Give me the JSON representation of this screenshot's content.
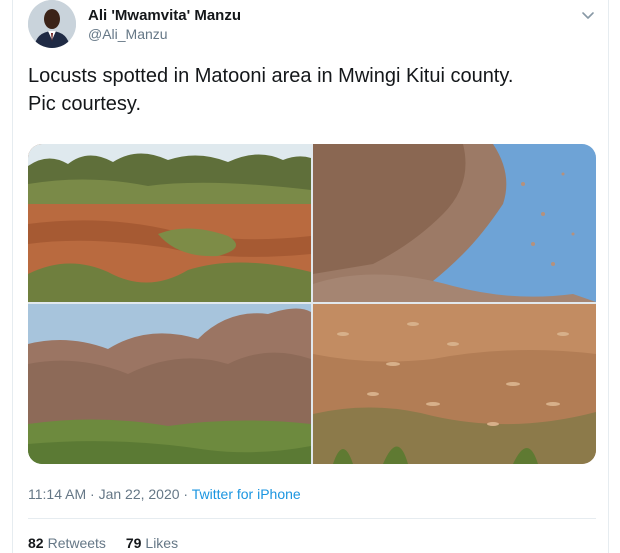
{
  "author": {
    "display_name": "Ali 'Mwamvita' Manzu",
    "handle": "@Ali_Manzu"
  },
  "tweet": {
    "text_line1": "Locusts spotted in Matooni area in Mwingi Kitui county.",
    "text_line2": "Pic courtesy."
  },
  "media": {
    "photos": [
      "photo-1",
      "photo-2",
      "photo-3",
      "photo-4"
    ]
  },
  "meta": {
    "time": "11:14 AM",
    "separator": " · ",
    "date": "Jan 22, 2020",
    "separator2": " · ",
    "source": "Twitter for iPhone"
  },
  "stats": {
    "retweets_count": "82",
    "retweets_label": "Retweets",
    "likes_count": "79",
    "likes_label": "Likes"
  },
  "icons": {
    "caret": "chevron-down-icon"
  },
  "colors": {
    "link": "#1b95e0",
    "muted": "#657786",
    "text": "#14171a",
    "border": "#e6ecf0"
  }
}
